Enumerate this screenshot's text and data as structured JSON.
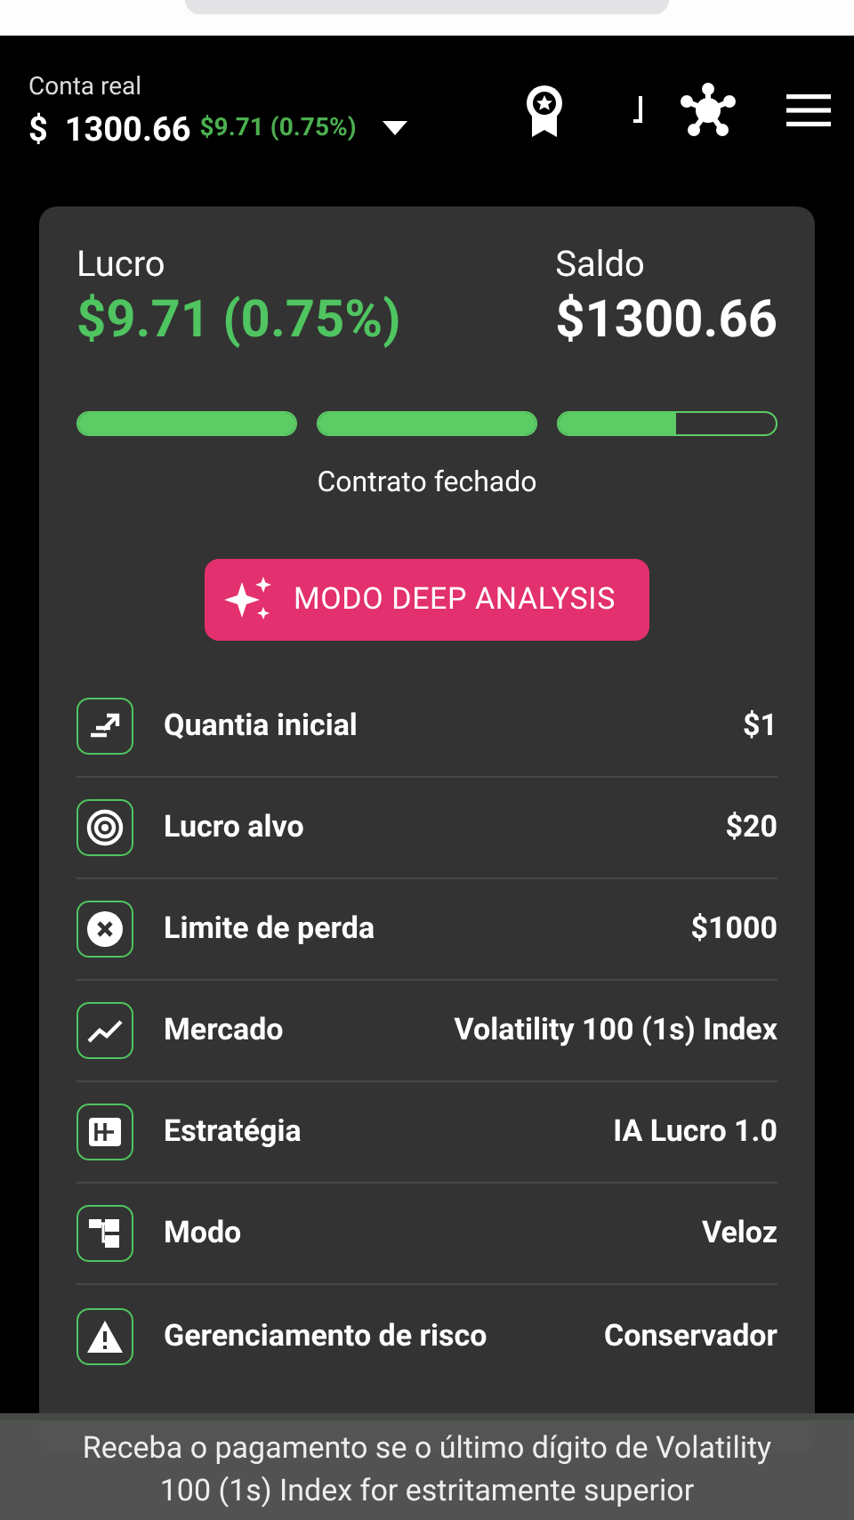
{
  "account": {
    "label": "Conta real",
    "currency": "$",
    "balance": "1300.66",
    "change": "$9.71 (0.75%)"
  },
  "summary": {
    "profit_label": "Lucro",
    "profit_value": "$9.71 (0.75%)",
    "balance_label": "Saldo",
    "balance_value": "$1300.66"
  },
  "progress": [
    {
      "level": 1
    },
    {
      "level": 1
    },
    {
      "level": 0.54
    }
  ],
  "status": "Contrato fechado",
  "analysis_button": "MODO DEEP ANALYSIS",
  "settings": [
    {
      "kind": "amount",
      "label": "Quantia inicial",
      "value": "$1"
    },
    {
      "kind": "target",
      "label": "Lucro alvo",
      "value": "$20"
    },
    {
      "kind": "stop",
      "label": "Limite de perda",
      "value": "$1000"
    },
    {
      "kind": "market",
      "label": "Mercado",
      "value": "Volatility 100 (1s) Index"
    },
    {
      "kind": "strategy",
      "label": "Estratégia",
      "value": "IA Lucro 1.0"
    },
    {
      "kind": "mode",
      "label": "Modo",
      "value": "Veloz"
    },
    {
      "kind": "risk",
      "label": "Gerenciamento de risco",
      "value": "Conservador"
    }
  ],
  "toast": "Receba o pagamento se o último dígito de Volatility 100 (1s) Index for estritamente superior"
}
